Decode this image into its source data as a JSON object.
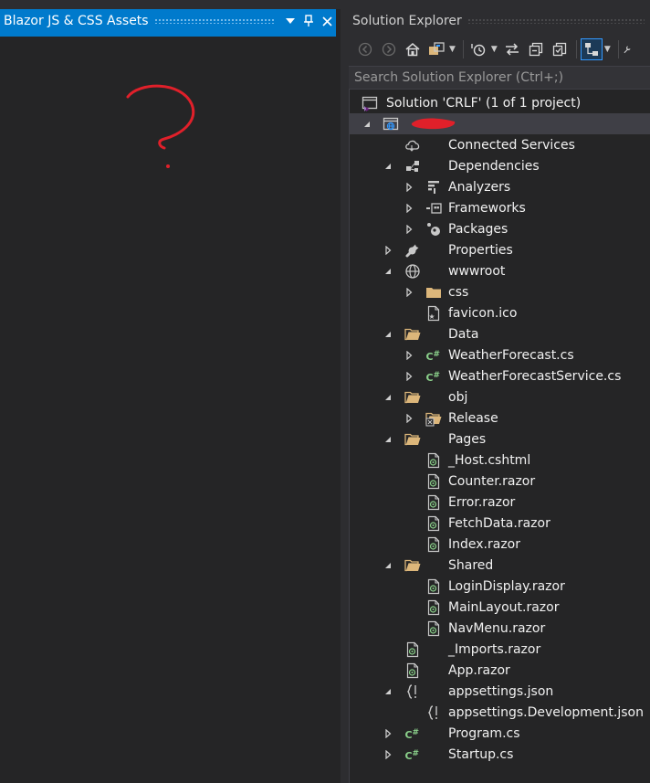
{
  "left_panel": {
    "title": "Blazor JS & CSS Assets",
    "annotation": "?"
  },
  "solution_explorer": {
    "title": "Solution Explorer",
    "search_placeholder": "Search Solution Explorer (Ctrl+;)",
    "toolbar": [
      "back-icon",
      "forward-icon",
      "home-icon",
      "switch-views-icon",
      "pending-changes-icon",
      "sync-icon",
      "collapse-all-icon",
      "show-all-files-icon",
      "preview-selected-icon",
      "properties-icon"
    ],
    "tree": [
      {
        "name": "solution-node",
        "label": "Solution 'CRLF' (1 of 1 project)",
        "level": 0,
        "expander": "none",
        "icon": "solution-icon"
      },
      {
        "name": "project-node",
        "label": "",
        "level": 1,
        "expander": "expanded",
        "icon": "globe-project-icon",
        "selected": true,
        "redacted": true
      },
      {
        "name": "connected-services-node",
        "label": "Connected Services",
        "level": 2,
        "expander": "none",
        "icon": "connected-services-icon"
      },
      {
        "name": "dependencies-node",
        "label": "Dependencies",
        "level": 2,
        "expander": "expanded",
        "icon": "dependencies-icon"
      },
      {
        "name": "analyzers-node",
        "label": "Analyzers",
        "level": 3,
        "expander": "collapsed",
        "icon": "analyzers-icon"
      },
      {
        "name": "frameworks-node",
        "label": "Frameworks",
        "level": 3,
        "expander": "collapsed",
        "icon": "frameworks-icon"
      },
      {
        "name": "packages-node",
        "label": "Packages",
        "level": 3,
        "expander": "collapsed",
        "icon": "packages-icon"
      },
      {
        "name": "properties-node",
        "label": "Properties",
        "level": 2,
        "expander": "collapsed",
        "icon": "wrench-icon"
      },
      {
        "name": "wwwroot-node",
        "label": "wwwroot",
        "level": 2,
        "expander": "expanded",
        "icon": "globe-icon"
      },
      {
        "name": "css-folder-node",
        "label": "css",
        "level": 3,
        "expander": "collapsed",
        "icon": "folder-closed-icon"
      },
      {
        "name": "favicon-node",
        "label": "favicon.ico",
        "level": 3,
        "expander": "none",
        "icon": "image-file-icon"
      },
      {
        "name": "data-folder-node",
        "label": "Data",
        "level": 2,
        "expander": "expanded",
        "icon": "folder-open-icon"
      },
      {
        "name": "weatherforecast-node",
        "label": "WeatherForecast.cs",
        "level": 3,
        "expander": "collapsed",
        "icon": "csharp-file-icon"
      },
      {
        "name": "weatherforecastservice-node",
        "label": "WeatherForecastService.cs",
        "level": 3,
        "expander": "collapsed",
        "icon": "csharp-file-icon"
      },
      {
        "name": "obj-folder-node",
        "label": "obj",
        "level": 2,
        "expander": "expanded",
        "icon": "folder-open-icon"
      },
      {
        "name": "release-folder-node",
        "label": "Release",
        "level": 3,
        "expander": "collapsed",
        "icon": "excluded-folder-icon"
      },
      {
        "name": "pages-folder-node",
        "label": "Pages",
        "level": 2,
        "expander": "expanded",
        "icon": "folder-open-icon"
      },
      {
        "name": "host-cshtml-node",
        "label": "_Host.cshtml",
        "level": 3,
        "expander": "none",
        "icon": "razor-file-icon"
      },
      {
        "name": "counter-razor-node",
        "label": "Counter.razor",
        "level": 3,
        "expander": "none",
        "icon": "razor-file-icon"
      },
      {
        "name": "error-razor-node",
        "label": "Error.razor",
        "level": 3,
        "expander": "none",
        "icon": "razor-file-icon"
      },
      {
        "name": "fetchdata-razor-node",
        "label": "FetchData.razor",
        "level": 3,
        "expander": "none",
        "icon": "razor-file-icon"
      },
      {
        "name": "index-razor-node",
        "label": "Index.razor",
        "level": 3,
        "expander": "none",
        "icon": "razor-file-icon"
      },
      {
        "name": "shared-folder-node",
        "label": "Shared",
        "level": 2,
        "expander": "expanded",
        "icon": "folder-open-icon"
      },
      {
        "name": "logindisplay-razor-node",
        "label": "LoginDisplay.razor",
        "level": 3,
        "expander": "none",
        "icon": "razor-file-icon"
      },
      {
        "name": "mainlayout-razor-node",
        "label": "MainLayout.razor",
        "level": 3,
        "expander": "none",
        "icon": "razor-file-icon"
      },
      {
        "name": "navmenu-razor-node",
        "label": "NavMenu.razor",
        "level": 3,
        "expander": "none",
        "icon": "razor-file-icon"
      },
      {
        "name": "imports-razor-node",
        "label": "_Imports.razor",
        "level": 2,
        "expander": "none",
        "icon": "razor-file-icon"
      },
      {
        "name": "app-razor-node",
        "label": "App.razor",
        "level": 2,
        "expander": "none",
        "icon": "razor-file-icon"
      },
      {
        "name": "appsettings-json-node",
        "label": "appsettings.json",
        "level": 2,
        "expander": "expanded",
        "icon": "json-file-icon"
      },
      {
        "name": "appsettings-dev-json-node",
        "label": "appsettings.Development.json",
        "level": 3,
        "expander": "none",
        "icon": "json-file-icon"
      },
      {
        "name": "program-cs-node",
        "label": "Program.cs",
        "level": 2,
        "expander": "collapsed",
        "icon": "csharp-file-icon"
      },
      {
        "name": "startup-cs-node",
        "label": "Startup.cs",
        "level": 2,
        "expander": "collapsed",
        "icon": "csharp-file-icon"
      }
    ]
  },
  "colors": {
    "accent": "#007acc",
    "background": "#252526",
    "chrome": "#2d2d30",
    "selection": "#3f3f46",
    "text": "#f1f1f1",
    "folder": "#dcb67a",
    "csharp": "#8bd18b",
    "annotation_red": "#e0202a"
  }
}
